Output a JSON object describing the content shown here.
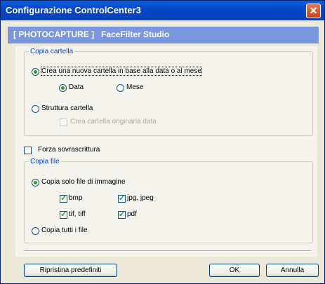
{
  "window": {
    "title": "Configurazione ControlCenter3",
    "close_icon": "close-icon"
  },
  "tabbar": {
    "tab1": "[ PHOTOCAPTURE ]",
    "tab2": "FaceFilter Studio"
  },
  "copia_cartella": {
    "legend": "Copia cartella",
    "option_new": "Crea una nuova cartella in base alla data o al mese",
    "option_new_selected": true,
    "sub_data": "Data",
    "sub_data_selected": true,
    "sub_mese": "Mese",
    "sub_mese_selected": false,
    "option_struttura": "Struttura cartella",
    "option_struttura_selected": false,
    "check_originaria": "Crea cartella originaria data",
    "check_originaria_checked": false,
    "check_originaria_enabled": false
  },
  "forza": {
    "label": "Forza sovrascrittura",
    "checked": false
  },
  "copia_file": {
    "legend": "Copia file",
    "option_solo": "Copia solo file di immagine",
    "option_solo_selected": true,
    "bmp": "bmp",
    "jpg": "jpg, jpeg",
    "tif": "tif, tiff",
    "pdf": "pdf",
    "option_tutti": "Copia tutti i file",
    "option_tutti_selected": false
  },
  "buttons": {
    "reset": "Ripristina predefiniti",
    "ok": "OK",
    "cancel": "Annulla"
  },
  "colors": {
    "titlebar": "#0548C8",
    "tabbar": "#7A96DF",
    "legend": "#0046D5",
    "check": "#21A121"
  }
}
